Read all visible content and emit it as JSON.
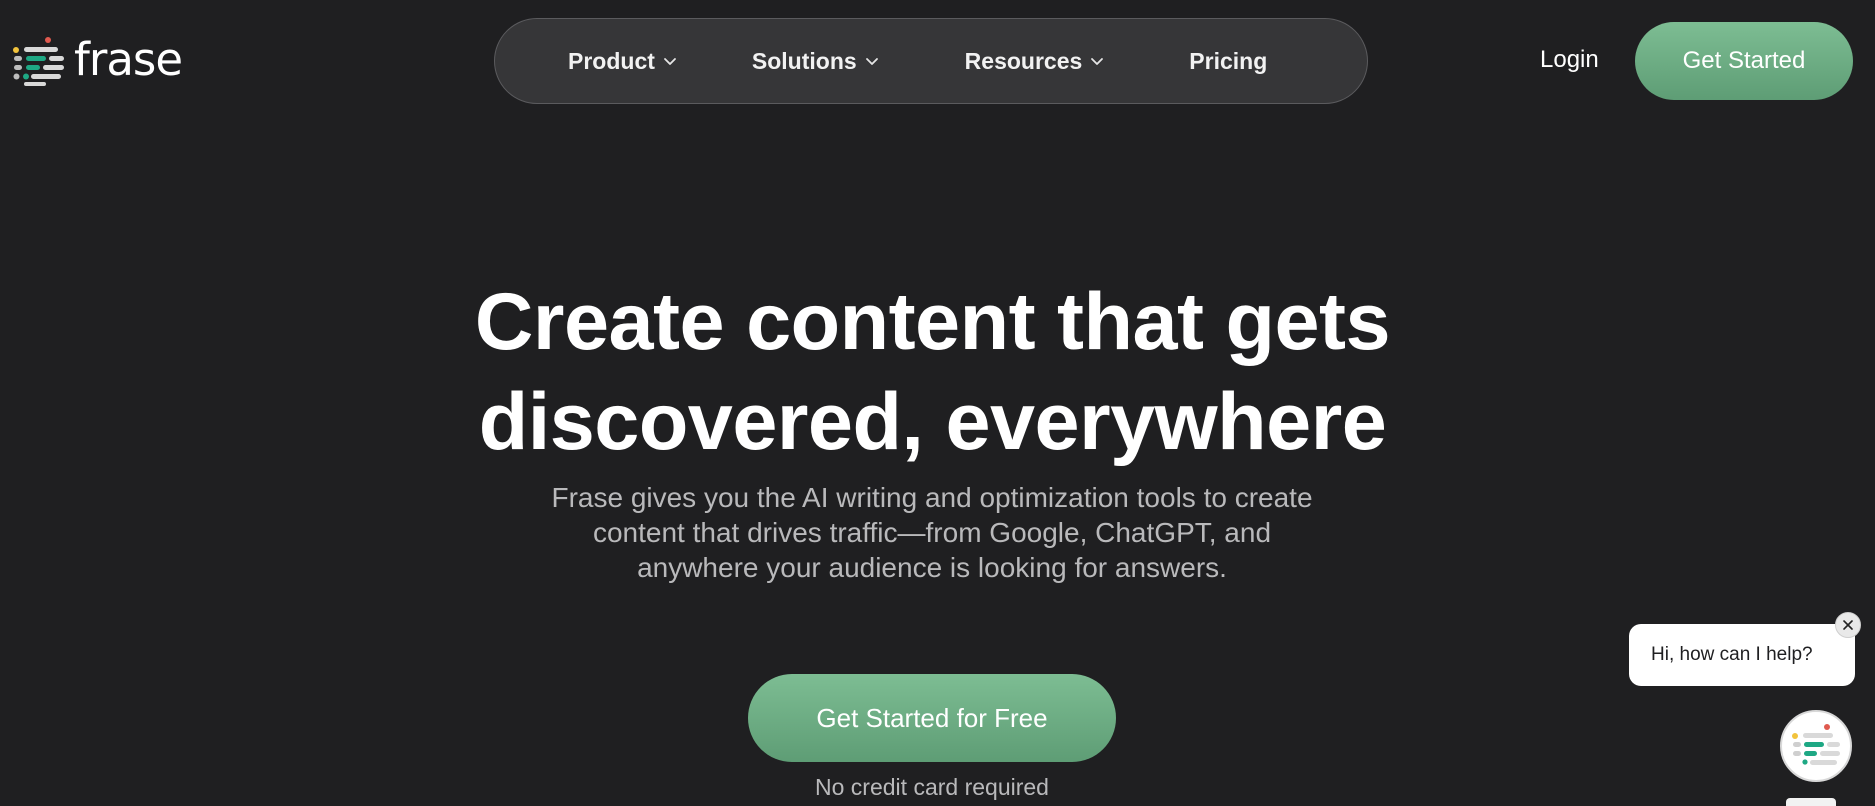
{
  "brand": {
    "name": "frase",
    "colors": {
      "background": "#1f1f21",
      "accent_green": "#6fae85",
      "nav_pill": "#363638"
    }
  },
  "header": {
    "nav": [
      {
        "label": "Product",
        "has_dropdown": true
      },
      {
        "label": "Solutions",
        "has_dropdown": true
      },
      {
        "label": "Resources",
        "has_dropdown": true
      },
      {
        "label": "Pricing",
        "has_dropdown": false
      }
    ],
    "login_label": "Login",
    "cta_label": "Get Started"
  },
  "hero": {
    "title_line1": "Create content that gets",
    "title_line2": "discovered, everywhere",
    "subtitle_line1": "Frase gives you the AI writing and optimization tools to create",
    "subtitle_line2": "content that drives traffic—from Google, ChatGPT, and",
    "subtitle_line3": "anywhere your audience is looking for answers.",
    "cta_label": "Get Started for Free",
    "cta_note": "No credit card required"
  },
  "chat": {
    "greeting": "Hi, how can I help?",
    "close_icon": "close-icon",
    "launcher_icon": "frase-logo-icon"
  }
}
